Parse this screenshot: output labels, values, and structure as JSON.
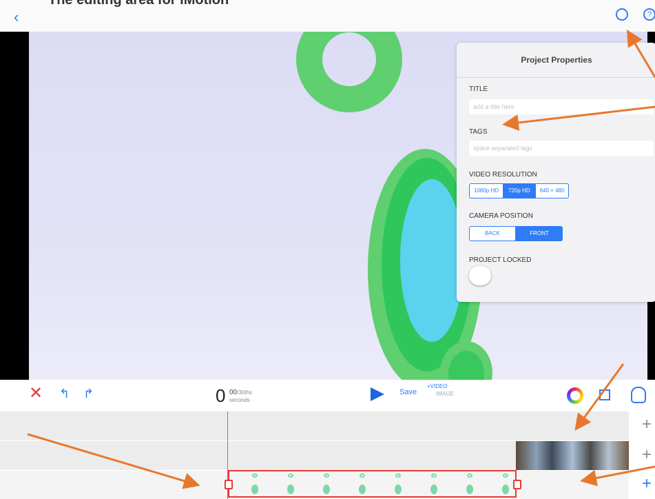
{
  "top_caption": "The editing area for iMotion",
  "nav": {
    "back_icon": "‹",
    "info_icon": "?"
  },
  "panel": {
    "title": "Project Properties",
    "title_label": "TITLE",
    "title_placeholder": "add a title here",
    "tags_label": "TAGS",
    "tags_placeholder": "space separated tags",
    "resolution_label": "VIDEO RESOLUTION",
    "resolution_options": [
      "1080p HD",
      "720p HD",
      "640 × 480"
    ],
    "resolution_selected": "720p HD",
    "camera_label": "CAMERA POSITION",
    "camera_options": [
      "BACK",
      "FRONT"
    ],
    "camera_selected": "FRONT",
    "locked_label": "PROJECT LOCKED",
    "locked": false
  },
  "toolbar": {
    "delete_icon": "✕",
    "undo_icon": "↰",
    "redo_icon": "↱",
    "time_seconds": "0",
    "time_frames": "00",
    "frames_unit": "/30ths",
    "seconds_label": "seconds",
    "save_label": "Save",
    "add_video_label": "+VIDEO",
    "image_label": "IMAGE"
  },
  "timeline": {
    "add_icon": "+"
  },
  "colors": {
    "accent": "#2f7cf6",
    "delete": "#e53935",
    "selection": "#e53935",
    "annotation_arrow": "#e8772e",
    "shape_green": "#5fcf6f",
    "shape_cyan": "#5bd3ee"
  }
}
